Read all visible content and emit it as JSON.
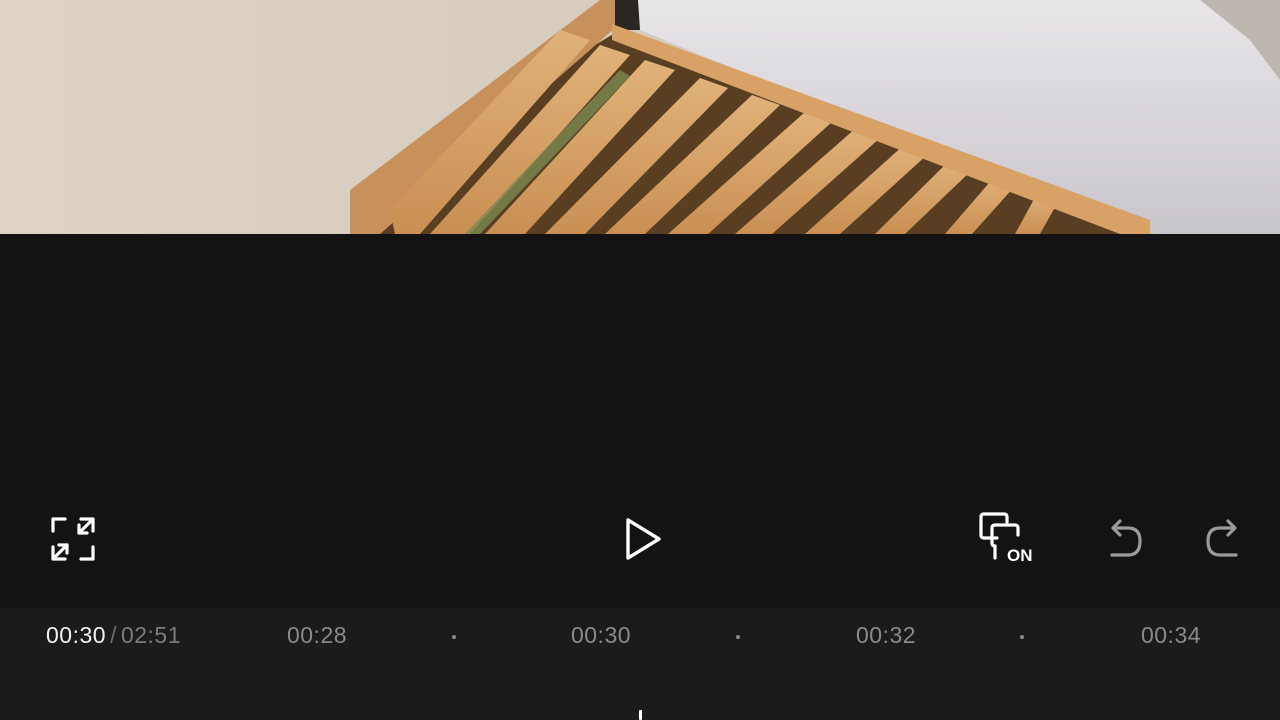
{
  "preview": {
    "frame_icon": "bed-frame-scene"
  },
  "controls": {
    "fullscreen_icon": "fullscreen-expand-icon",
    "play_icon": "play-icon",
    "keyframe_icon": "keyframe-toggle-icon",
    "keyframe_state": "ON",
    "undo_icon": "undo-icon",
    "redo_icon": "redo-icon"
  },
  "timeline": {
    "current_time": "00:30",
    "separator": "/",
    "total_time": "02:51",
    "ruler_labels": [
      "00:28",
      "00:30",
      "00:32",
      "00:34"
    ]
  },
  "colors": {
    "background": "#131314",
    "timeline_background": "#1b1b1c",
    "icon": "#ffffff",
    "icon_disabled": "#9a9a9d",
    "ruler_text": "#8a8a8d"
  }
}
